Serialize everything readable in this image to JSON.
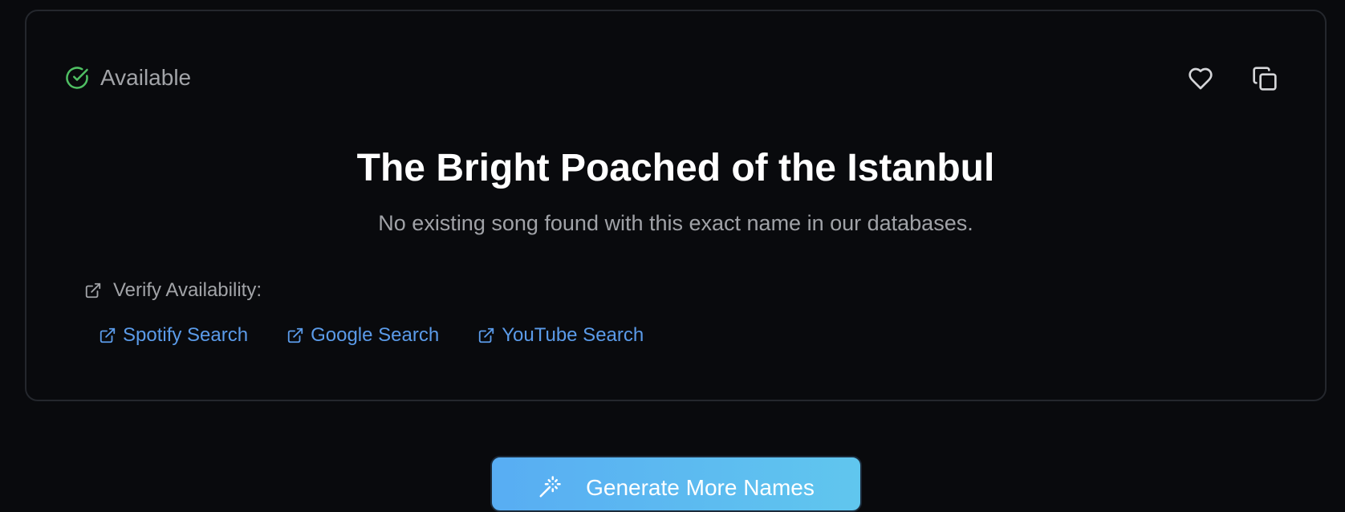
{
  "result": {
    "status_label": "Available",
    "title": "The Bright Poached of the Istanbul",
    "subtitle": "No existing song found with this exact name in our databases.",
    "verify_label": "Verify Availability:",
    "links": [
      {
        "label": "Spotify Search"
      },
      {
        "label": "Google Search"
      },
      {
        "label": "YouTube Search"
      }
    ]
  },
  "actions": {
    "generate_label": "Generate More Names"
  },
  "colors": {
    "background": "#090a0d",
    "card_border": "#24272d",
    "available_green": "#4fbf63",
    "link_blue": "#5b9be9",
    "button_gradient_start": "#58adf3",
    "button_gradient_end": "#60c6ee"
  },
  "icons": {
    "status": "check-circle-icon",
    "favorite": "heart-icon",
    "copy": "copy-icon",
    "external": "external-link-icon",
    "generate": "magic-wand-icon"
  }
}
